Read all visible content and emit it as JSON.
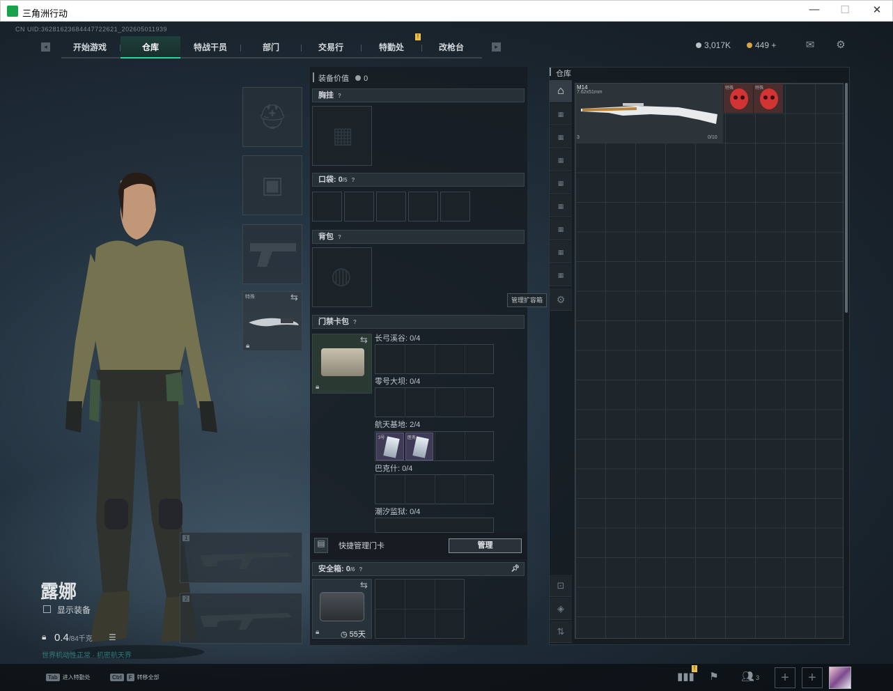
{
  "window": {
    "title": "三角洲行动",
    "min": "—",
    "max": "☐",
    "close": "✕"
  },
  "uid": "CN UID:36281623684447722621_202605011939",
  "tabs": [
    "开始游戏",
    "仓库",
    "特战干员",
    "部门",
    "交易行",
    "特勤处",
    "改枪台"
  ],
  "tab_badge": "!",
  "currency": {
    "coins": "3,017K",
    "tokens": "449",
    "plus": "+"
  },
  "equip": {
    "value_label": "装备价值",
    "value": "0",
    "chest_rig": "胸挂",
    "pouch_label": "口袋:",
    "pouch_value": "0",
    "pouch_max": "/5",
    "backpack": "背包",
    "card_bag": "门禁卡包",
    "help": "?",
    "maps": [
      {
        "name": "长弓溪谷: 0/4"
      },
      {
        "name": "零号大坝: 0/4"
      },
      {
        "name": "航天基地: 2/4"
      },
      {
        "name": "巴克什: 0/4"
      },
      {
        "name": "潮汐监狱: 0/4"
      }
    ],
    "cards": [
      {
        "tag": "3号"
      },
      {
        "tag": "医务"
      }
    ],
    "quick_card": "快捷管理门卡",
    "manage": "管理",
    "safe_label": "安全箱:",
    "safe_value": "0",
    "safe_max": "/6",
    "safe_days": "55天",
    "pin": "⊕"
  },
  "loadout": {
    "melee_tag": "特殊",
    "slot1": "1",
    "slot2": "2"
  },
  "character": {
    "name": "露娜",
    "show_equip": "显示装备",
    "weight": "0.4",
    "weight_max": "/84千克",
    "status": "世界机动性正常 · 机密航天界"
  },
  "warehouse": {
    "label": "仓库",
    "tooltip": "管理扩容箱",
    "gun_name": "M14",
    "gun_caliber": "7.62x51mm",
    "gun_ammo": "0/10",
    "gun_mark": "3",
    "mask_tag": "特殊"
  },
  "bottom": {
    "tab_key": "Tab",
    "tab_text": "进入特勤处",
    "ctrl_key": "Ctrl",
    "f_key": "F",
    "ctrl_text": "转移全部",
    "players": "3",
    "badge": "!"
  }
}
